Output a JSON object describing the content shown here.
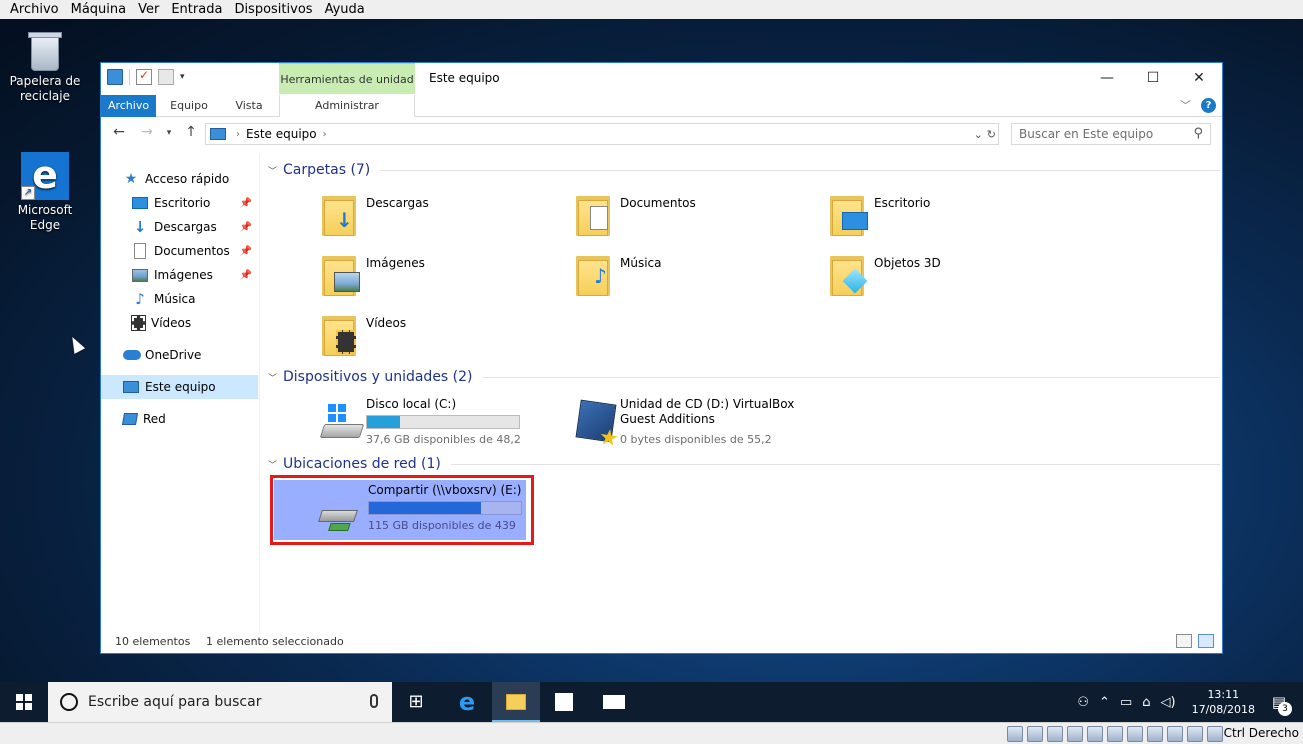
{
  "vbox_menu": [
    "Archivo",
    "Máquina",
    "Ver",
    "Entrada",
    "Dispositivos",
    "Ayuda"
  ],
  "desktop": {
    "recycle_bin_label": "Papelera de reciclaje",
    "edge_label": "Microsoft Edge",
    "edge_glyph": "e"
  },
  "window": {
    "title": "Este equipo",
    "tools_tab": "Herramientas de unidad",
    "ribbon_tabs": {
      "archivo": "Archivo",
      "equipo": "Equipo",
      "vista": "Vista",
      "administrar": "Administrar"
    },
    "controls": {
      "minimize": "—",
      "maximize": "☐",
      "close": "✕",
      "help": "?"
    }
  },
  "nav": {
    "back": "←",
    "forward": "→",
    "recent": "▾",
    "up": "↑",
    "address": "Este equipo",
    "search_placeholder": "Buscar en Este equipo"
  },
  "sidebar": {
    "items": [
      {
        "label": "Acceso rápido",
        "icon": "star-icon"
      },
      {
        "label": "Escritorio",
        "icon": "desktop-icon",
        "pinned": true
      },
      {
        "label": "Descargas",
        "icon": "download-icon",
        "pinned": true
      },
      {
        "label": "Documentos",
        "icon": "document-icon",
        "pinned": true
      },
      {
        "label": "Imágenes",
        "icon": "image-icon",
        "pinned": true
      },
      {
        "label": "Música",
        "icon": "music-icon"
      },
      {
        "label": "Vídeos",
        "icon": "video-icon"
      },
      {
        "label": "OneDrive",
        "icon": "cloud-icon"
      },
      {
        "label": "Este equipo",
        "icon": "computer-icon",
        "selected": true
      },
      {
        "label": "Red",
        "icon": "network-icon"
      }
    ]
  },
  "content": {
    "groups": {
      "folders": "Carpetas (7)",
      "devices": "Dispositivos y unidades (2)",
      "network": "Ubicaciones de red (1)"
    },
    "folders": [
      "Descargas",
      "Documentos",
      "Escritorio",
      "Imágenes",
      "Música",
      "Objetos 3D",
      "Vídeos"
    ],
    "drives": [
      {
        "name": "Disco local (C:)",
        "free": "37,6 GB disponibles de 48,2",
        "used_fraction": 0.22
      },
      {
        "name": "Unidad de CD (D:) VirtualBox",
        "name2": "Guest Additions",
        "free": "0 bytes disponibles de 55,2"
      }
    ],
    "network": {
      "name": "Compartir (\\\\vboxsrv) (E:)",
      "free": "115 GB disponibles de 439",
      "used_fraction": 0.74
    }
  },
  "status": {
    "count": "10 elementos",
    "selection": "1 elemento seleccionado"
  },
  "taskbar": {
    "search_placeholder": "Escribe aquí para buscar",
    "time": "13:11",
    "date": "17/08/2018",
    "notification_count": "3"
  },
  "vbox_status": {
    "host_key": "Ctrl Derecho"
  }
}
